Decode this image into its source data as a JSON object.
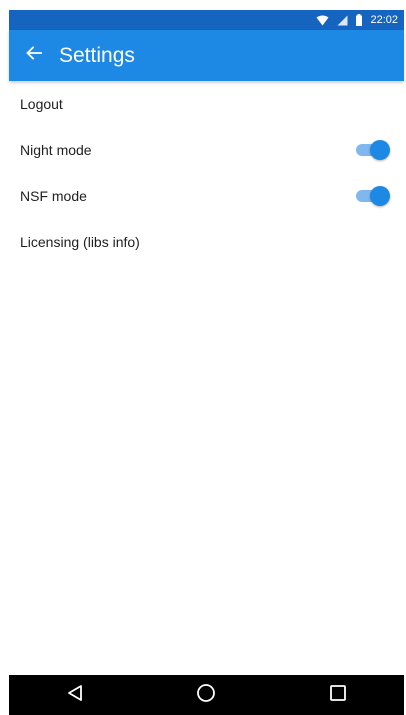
{
  "status_bar": {
    "time": "22:02",
    "icons": [
      "wifi-icon",
      "signal-icon",
      "battery-icon"
    ]
  },
  "app_bar": {
    "title": "Settings",
    "back_icon": "arrow-left-icon"
  },
  "settings": {
    "items": [
      {
        "label": "Logout"
      },
      {
        "label": "Night mode",
        "toggle_on": true
      },
      {
        "label": "NSF mode",
        "toggle_on": true
      },
      {
        "label": "Licensing (libs info)"
      }
    ]
  },
  "nav_bar": {
    "icons": [
      "back-triangle-icon",
      "home-circle-icon",
      "recents-square-icon"
    ]
  },
  "colors": {
    "status_bar": "#1565C0",
    "app_bar": "#1E88E5",
    "toggle_thumb": "#1E88E5",
    "toggle_track": "#7FB7EF",
    "nav_bar": "#000000"
  }
}
